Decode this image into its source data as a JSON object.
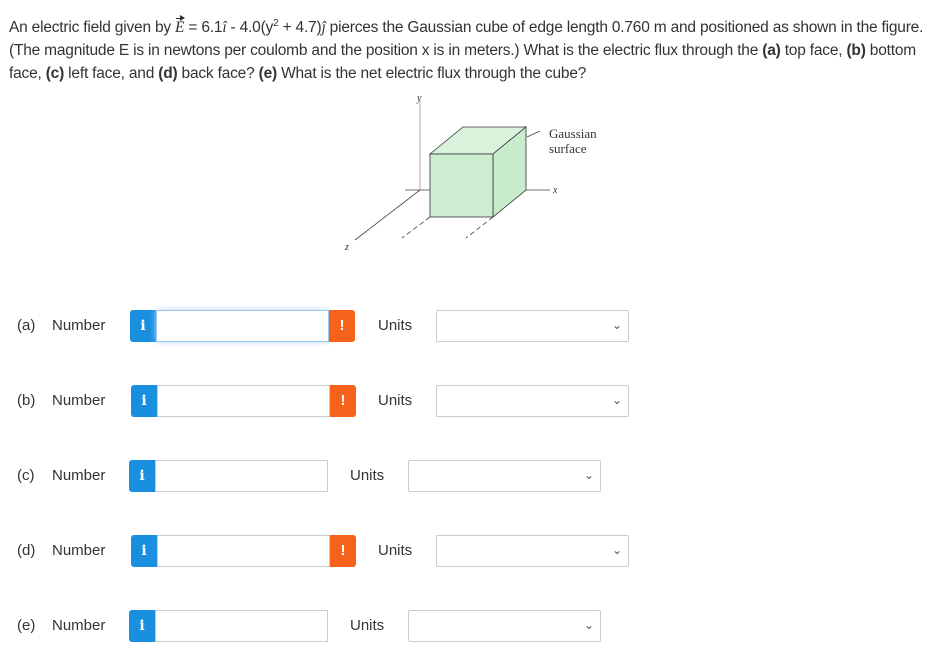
{
  "question": {
    "p1": "An electric field given by ",
    "E": "E",
    "p2": " = 6.1",
    "ihat": "î",
    "p3": " - 4.0(y",
    "sup": "2",
    "p4": " + 4.7)",
    "jhat": "ĵ",
    "p5": " pierces the Gaussian cube of edge length 0.760 m and positioned as shown in the figure. (The magnitude E is in newtons per coulomb and the position x is in meters.) What is the electric flux through the ",
    "a": "(a)",
    "a_t": " top face, ",
    "b": "(b)",
    "b_t": " bottom face, ",
    "c": "(c)",
    "c_t": " left face, and ",
    "d": "(d)",
    "d_t": " back face? ",
    "e": "(e)",
    "e_t": " What is the net electric flux through the cube?"
  },
  "figure": {
    "y_label": "y",
    "x_label": "x",
    "z_label": "z",
    "surface_label_1": "Gaussian",
    "surface_label_2": "surface",
    "cube_color": "#d6f0d8"
  },
  "colors": {
    "info": "#1a8fe0",
    "warning": "#f6621a"
  },
  "rows": [
    {
      "part": "(a)",
      "label": "Number",
      "value": "",
      "units_label": "Units",
      "units_value": "",
      "warning": true,
      "focused": true
    },
    {
      "part": "(b)",
      "label": "Number",
      "value": "",
      "units_label": "Units",
      "units_value": "",
      "warning": true
    },
    {
      "part": "(c)",
      "label": "Number",
      "value": "",
      "units_label": "Units",
      "units_value": "",
      "warning": false
    },
    {
      "part": "(d)",
      "label": "Number",
      "value": "",
      "units_label": "Units",
      "units_value": "",
      "warning": true
    },
    {
      "part": "(e)",
      "label": "Number",
      "value": "",
      "units_label": "Units",
      "units_value": "",
      "warning": false
    }
  ],
  "icons": {
    "info": "i",
    "warning": "!",
    "chevron": "⌄"
  }
}
